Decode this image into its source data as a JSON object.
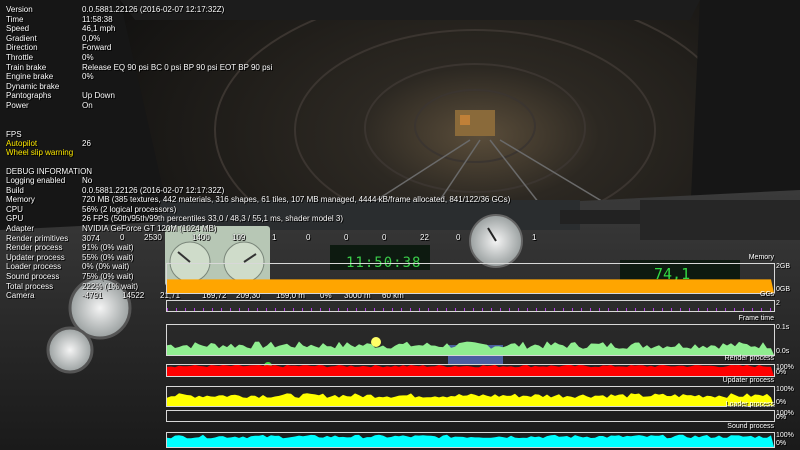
{
  "hud": {
    "status": [
      {
        "label": "Version",
        "value": "0.0.5881.22126 (2016-02-07 12:17:32Z)"
      },
      {
        "label": "Time",
        "value": "11:58:38"
      },
      {
        "label": "Speed",
        "value": "46,1 mph"
      },
      {
        "label": "Gradient",
        "value": "0,0%"
      },
      {
        "label": "Direction",
        "value": "Forward"
      },
      {
        "label": "Throttle",
        "value": "0%"
      },
      {
        "label": "Train brake",
        "value": "Release EQ 90 psi BC 0 psi BP 90 psi EOT BP 90 psi"
      },
      {
        "label": "Engine brake",
        "value": "0%"
      },
      {
        "label": "Dynamic brake",
        "value": ""
      },
      {
        "label": "Pantographs",
        "value": "Up Down"
      },
      {
        "label": "Power",
        "value": "On"
      }
    ],
    "fps": {
      "label": "FPS",
      "value": "26"
    },
    "warnings": [
      "Autopilot",
      "Wheel slip warning"
    ],
    "debug_title": "DEBUG INFORMATION",
    "debug": [
      {
        "label": "Logging enabled",
        "value": "No"
      },
      {
        "label": "Build",
        "value": "0.0.5881.22126 (2016-02-07 12:17:32Z)"
      },
      {
        "label": "Memory",
        "value": "720 MB (385 textures, 442 materials, 316 shapes, 61 tiles, 107 MB managed, 4444 kB/frame allocated, 841/122/36 GCs)"
      },
      {
        "label": "CPU",
        "value": "56% (2 logical processors)"
      },
      {
        "label": "GPU",
        "value": "26 FPS (50th/95th/99th percentiles 33,0 / 48,3 / 55,1 ms, shader model 3)"
      },
      {
        "label": "Adapter",
        "value": "NVIDIA GeForce GT 120M (1024 MB)"
      },
      {
        "label": "Render primitives",
        "value": "3074"
      },
      {
        "label": "Render process",
        "value": "91% (0% wait)"
      },
      {
        "label": "Updater process",
        "value": "55% (0% wait)"
      },
      {
        "label": "Loader process",
        "value": "0% (0% wait)"
      },
      {
        "label": "Sound process",
        "value": "75% (0% wait)"
      },
      {
        "label": "Total process",
        "value": "222% (1% wait)"
      },
      {
        "label": "Camera",
        "value": "-4791"
      }
    ],
    "primitive_counts": [
      "0",
      "2530",
      "1400",
      "109",
      "1",
      "0",
      "0",
      "0",
      "22",
      "0",
      "1"
    ],
    "camera_extra": [
      "14522",
      "21,71",
      "169,72",
      "209,30",
      "159,0 m",
      "0%",
      "3000 m",
      "60 km"
    ]
  },
  "cab": {
    "clock": "11:50:38",
    "speed_readout": "74,1"
  },
  "graphs": [
    {
      "name": "Memory",
      "scale_top": "2GB",
      "scale_bottom": "0GB",
      "color": "#ffa500",
      "level": 0.47
    },
    {
      "name": "GCs",
      "scale_top": "2",
      "scale_bottom": "",
      "color": "#b040e0",
      "level": 0.1
    },
    {
      "name": "Frame time",
      "scale_top": "0.1s",
      "scale_bottom": "0.0s",
      "color": "#90ee90",
      "level": 0.33
    },
    {
      "name": "Render process",
      "scale_top": "100%",
      "scale_bottom": "0%",
      "color": "#ff0000",
      "level": 0.91
    },
    {
      "name": "Updater process",
      "scale_top": "100%",
      "scale_bottom": "0%",
      "color": "#ffff00",
      "level": 0.55
    },
    {
      "name": "Loader process",
      "scale_top": "100%",
      "scale_bottom": "0%",
      "color": "#3fa0ff",
      "level": 0.0
    },
    {
      "name": "Sound process",
      "scale_top": "100%",
      "scale_bottom": "0%",
      "color": "#00ffff",
      "level": 0.75
    }
  ]
}
